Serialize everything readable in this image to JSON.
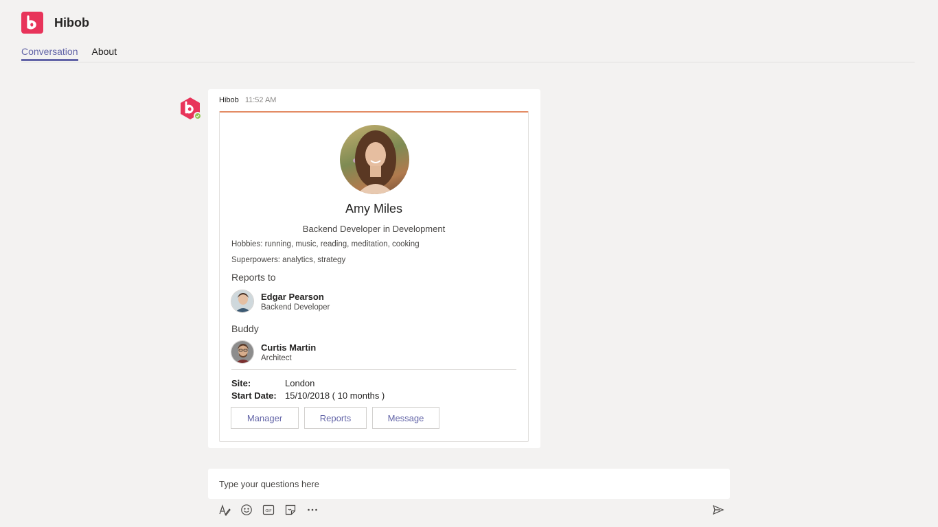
{
  "app": {
    "title": "Hibob",
    "brand_color": "#e8345a",
    "accent_color": "#6264a7",
    "logo_icon": "hibob-logo-icon"
  },
  "tabs": [
    {
      "label": "Conversation",
      "active": true
    },
    {
      "label": "About",
      "active": false
    }
  ],
  "message": {
    "sender": "Hibob",
    "time": "11:52 AM",
    "presence": "available",
    "card": {
      "accent_color": "#e38b63",
      "name": "Amy Miles",
      "role": "Backend Developer in Development",
      "hobbies": "Hobbies: running, music, reading, meditation, cooking",
      "superpowers": "Superpowers: analytics, strategy",
      "reports_to_label": "Reports to",
      "manager": {
        "name": "Edgar Pearson",
        "title": "Backend Developer"
      },
      "buddy_label": "Buddy",
      "buddy": {
        "name": "Curtis Martin",
        "title": "Architect"
      },
      "facts": [
        {
          "key": "Site:",
          "value": "London"
        },
        {
          "key": "Start Date:",
          "value": "15/10/2018 ( 10 months )"
        }
      ],
      "actions": [
        "Manager",
        "Reports",
        "Message"
      ]
    }
  },
  "compose": {
    "placeholder": "Type your questions here"
  },
  "toolbar_icons": [
    "format-icon",
    "emoji-icon",
    "gif-icon",
    "sticker-icon",
    "more-options-icon"
  ],
  "send_icon": "send-icon"
}
